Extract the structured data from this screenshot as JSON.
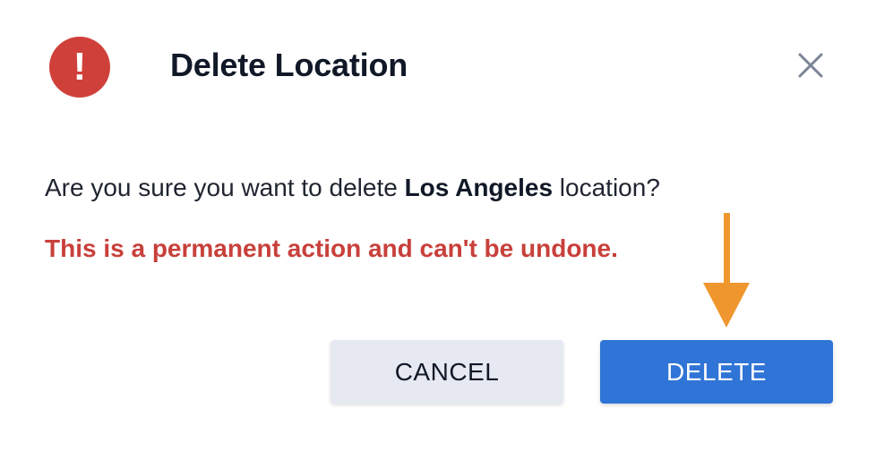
{
  "dialog": {
    "title": "Delete Location",
    "alert_icon_glyph": "!",
    "alert_icon_name": "exclamation-circle-icon",
    "close_icon_name": "close-icon",
    "message_prefix": "Are you sure you want to delete ",
    "message_location": "Los Angeles",
    "message_suffix": " location?",
    "warning": "This is a permanent action and can't be undone.",
    "cancel_label": "CANCEL",
    "delete_label": "DELETE"
  },
  "annotation": {
    "arrow_icon_name": "down-arrow-annotation-icon",
    "arrow_color": "#f0962e"
  },
  "colors": {
    "alert": "#d0403a",
    "warning_text": "#c8403b",
    "primary": "#2f74d6",
    "secondary": "#e6e9f1"
  }
}
